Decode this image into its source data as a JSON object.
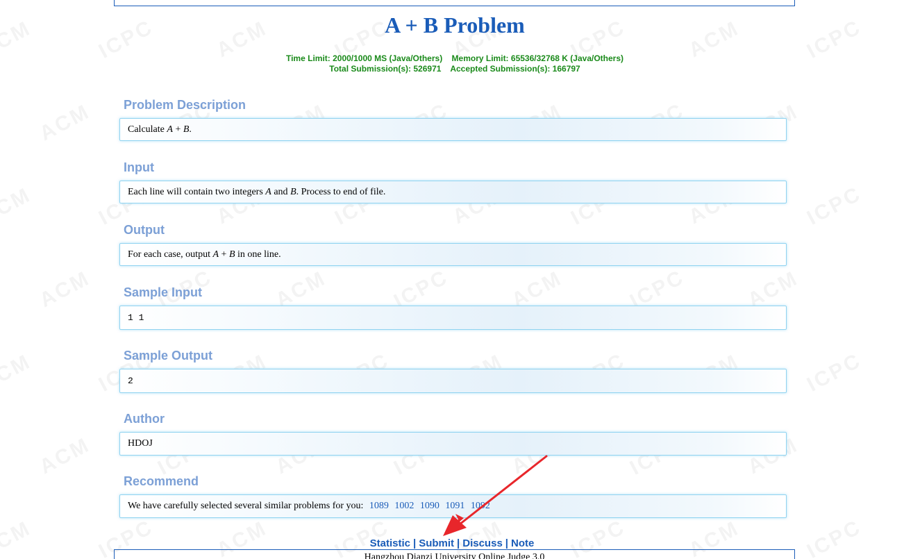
{
  "problem": {
    "title": "A + B Problem",
    "time_limit": "Time Limit: 2000/1000 MS (Java/Others)",
    "memory_limit": "Memory Limit: 65536/32768 K (Java/Others)",
    "total_submissions": "Total Submission(s): 526971",
    "accepted_submissions": "Accepted Submission(s): 166797"
  },
  "sections": {
    "description": {
      "heading": "Problem Description",
      "text_before": "Calculate ",
      "var_a": "A",
      "plus": " + ",
      "var_b": "B",
      "text_after": "."
    },
    "input": {
      "heading": "Input",
      "text_before": "Each line will contain two integers ",
      "var_a": "A",
      "and": " and ",
      "var_b": "B",
      "text_after": ". Process to end of file."
    },
    "output": {
      "heading": "Output",
      "text_before": "For each case, output ",
      "var_a": "A",
      "plus": " + ",
      "var_b": "B",
      "text_after": " in one line."
    },
    "sample_input": {
      "heading": "Sample Input",
      "text": "1 1"
    },
    "sample_output": {
      "heading": "Sample Output",
      "text": "2"
    },
    "author": {
      "heading": "Author",
      "text": "HDOJ"
    },
    "recommend": {
      "heading": "Recommend",
      "text": "We have carefully selected several similar problems for you:",
      "links": [
        "1089",
        "1002",
        "1090",
        "1091",
        "1092"
      ]
    }
  },
  "nav": {
    "statistic": "Statistic",
    "submit": "Submit",
    "discuss": "Discuss",
    "note": "Note",
    "separator": "|"
  },
  "footer": {
    "text": "Hangzhou Dianzi University Online Judge 3.0"
  },
  "watermark": {
    "acm": "ACM",
    "icpc": "ICPC"
  },
  "colors": {
    "title_blue": "#1a5cb8",
    "limit_green": "#1a8a1a",
    "heading_blue": "#7ca0d6",
    "panel_border": "#8fd3f0",
    "annotation_red": "#e8262b"
  },
  "annotation": {
    "icon": "red-arrow-icon"
  }
}
